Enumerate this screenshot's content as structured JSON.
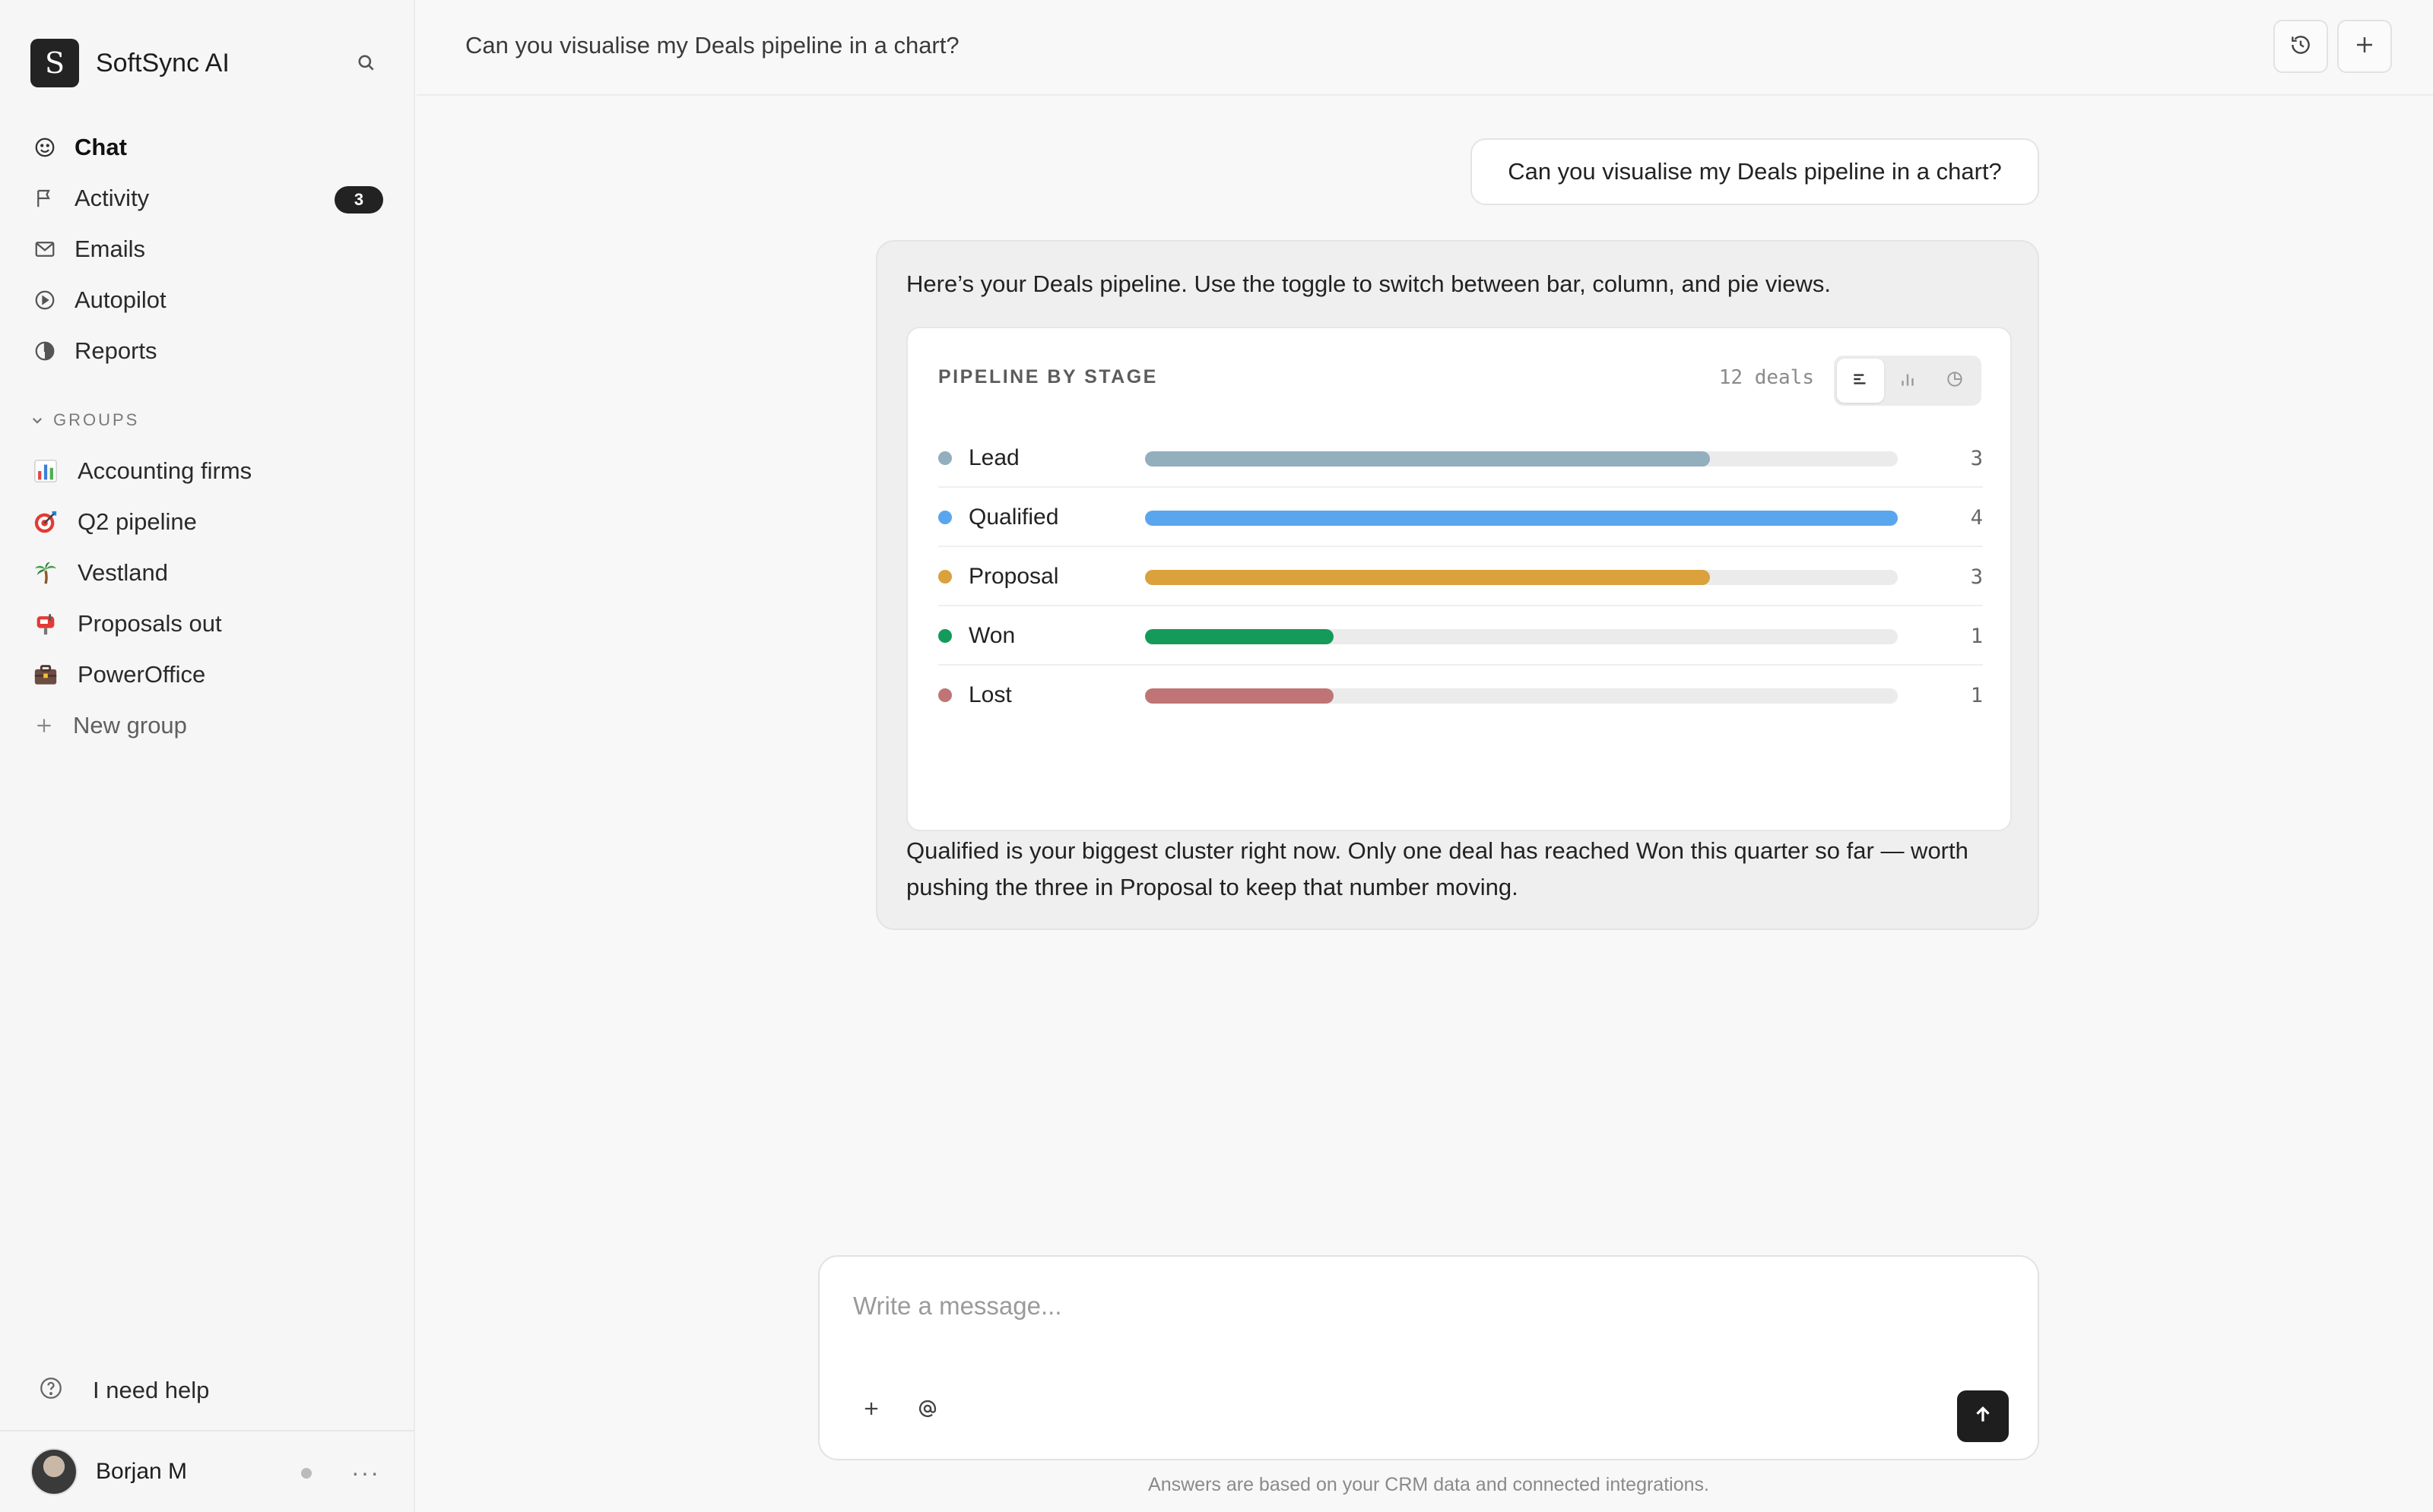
{
  "app": {
    "name": "SoftSync AI",
    "logo_letter": "S"
  },
  "sidebar": {
    "nav": [
      {
        "label": "Chat",
        "icon": "smile-icon",
        "active": true
      },
      {
        "label": "Activity",
        "icon": "flag-icon",
        "badge": "3"
      },
      {
        "label": "Emails",
        "icon": "mail-icon"
      },
      {
        "label": "Autopilot",
        "icon": "play-circle-icon"
      },
      {
        "label": "Reports",
        "icon": "pie-icon"
      }
    ],
    "groups_heading": "GROUPS",
    "groups": [
      {
        "label": "Accounting firms",
        "icon": "bar-chart-emoji-icon"
      },
      {
        "label": "Q2 pipeline",
        "icon": "target-emoji-icon"
      },
      {
        "label": "Vestland",
        "icon": "palm-tree-emoji-icon"
      },
      {
        "label": "Proposals out",
        "icon": "mailbox-emoji-icon"
      },
      {
        "label": "PowerOffice",
        "icon": "briefcase-emoji-icon"
      }
    ],
    "new_group_label": "New group",
    "help_label": "I need help",
    "user": {
      "name": "Borjan M"
    }
  },
  "header": {
    "title": "Can you visualise my Deals pipeline in a chart?"
  },
  "conversation": {
    "user_message": "Can you visualise my Deals pipeline in a chart?",
    "assistant_intro": "Here’s your Deals pipeline. Use the toggle to switch between bar, column, and pie views.",
    "assistant_summary": "Qualified is your biggest cluster right now. Only one deal has reached Won this quarter so far — worth pushing the three in Proposal to keep that number moving."
  },
  "pipeline_card": {
    "title": "PIPELINE BY STAGE",
    "count_label": "12 deals",
    "view_toggle": [
      "bar-view-icon",
      "column-view-icon",
      "pie-view-icon"
    ],
    "active_view": "bar",
    "colors": {
      "Lead": "#93aebd",
      "Qualified": "#5aa6ee",
      "Proposal": "#dba13c",
      "Won": "#149a5a",
      "Lost": "#bf7575"
    }
  },
  "chart_data": {
    "type": "bar",
    "orientation": "horizontal",
    "title": "PIPELINE BY STAGE",
    "categories": [
      "Lead",
      "Qualified",
      "Proposal",
      "Won",
      "Lost"
    ],
    "values": [
      3,
      4,
      3,
      1,
      1
    ],
    "xlim": [
      0,
      4
    ]
  },
  "composer": {
    "placeholder": "Write a message...",
    "disclaimer": "Answers are based on your CRM data and connected integrations."
  }
}
